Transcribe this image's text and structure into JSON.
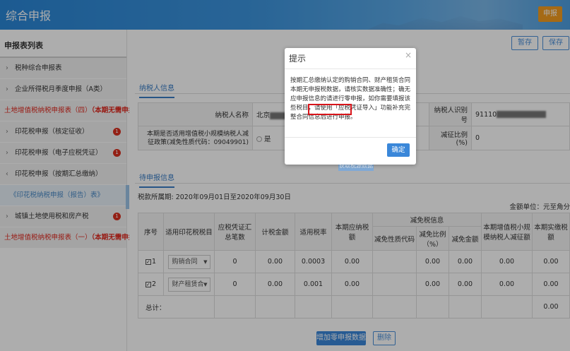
{
  "header": {
    "title": "综合申报",
    "submit_label": "申报"
  },
  "sidebar": {
    "title": "申报表列表",
    "items": [
      {
        "label": "税种综合申报表",
        "type": "normal"
      },
      {
        "label": "企业所得税月季度申报（A类）",
        "type": "normal"
      },
      {
        "label_prefix": "土地增值税纳税申报表（四）",
        "label_bold": "（本期无需申报）",
        "type": "red"
      },
      {
        "label": "印花税申报（核定征收）",
        "type": "normal",
        "badge": "1"
      },
      {
        "label": "印花税申报（电子应税凭证）",
        "type": "normal",
        "badge": "1"
      },
      {
        "label": "印花税申报（按期汇总缴纳）",
        "type": "expanded"
      },
      {
        "label": "《印花税纳税申报（报告）表》",
        "type": "sub"
      },
      {
        "label": "城镇土地使用税和房产税",
        "type": "normal",
        "badge": "1"
      },
      {
        "label_prefix": "土地增值税纳税申报表（一）",
        "label_bold": "（本期无需申报）",
        "type": "red"
      }
    ]
  },
  "toolbar": {
    "save_draft_label": "暂存",
    "save_label": "保存"
  },
  "taxpayer_section": {
    "tab_label": "纳税人信息",
    "name_label": "纳税人名称",
    "name_value_visible": "北京",
    "tax_id_label": "纳税人识别号",
    "tax_id_value_visible": "91110",
    "policy_label": "本期是否适用增值税小规模纳税人减征政策(减免性质代码：09049901)",
    "policy_value": "是",
    "reduction_ratio_label": "减征比例(%)",
    "reduction_ratio_value": "0"
  },
  "pending_section": {
    "tab_label": "待申报信息",
    "period": "税款所属期: 2020年09月01日至2020年09月30日",
    "unit": "金额单位：元至角分",
    "columns": {
      "seq": "序号",
      "item": "适用印花税税目",
      "voucher_count": "应税凭证汇总笔数",
      "tax_base": "计税金额",
      "rate": "适用税率",
      "tax_payable": "本期应纳税额",
      "relief_group": "减免税信息",
      "relief_code": "减免性质代码",
      "relief_ratio": "减免比例（%）",
      "relief_amount": "减免金额",
      "small_scale": "本期增值税小规模纳税人减征额",
      "actual_paid": "本期实缴税额"
    },
    "rows": [
      {
        "seq": "1",
        "checked": true,
        "item": "购销合同",
        "count": "0",
        "base": "0.00",
        "rate": "0.0003",
        "payable": "0.00",
        "code": "",
        "ratio": "0.00",
        "relief": "0.00",
        "small": "0.00",
        "actual": "0.00"
      },
      {
        "seq": "2",
        "checked": true,
        "item": "财产租赁合",
        "count": "0",
        "base": "0.00",
        "rate": "0.001",
        "payable": "0.00",
        "code": "",
        "ratio": "0.00",
        "relief": "0.00",
        "small": "0.00",
        "actual": "0.00"
      }
    ],
    "total_label": "总计：",
    "total_actual": "0.00"
  },
  "actions": {
    "add_zero_label": "增加零申报数据行",
    "delete_label": "删除",
    "hidden_button_label": "获取税源数据"
  },
  "modal": {
    "title": "提示",
    "close_symbol": "×",
    "body": "按期汇总缴纳认定的购销合同、财产租赁合同本期无申报税数据，请核实数据准确性；确无应申报信息的请进行零申报，如你需要填报该些税目，请使用「应税凭证导入」功能补充完整合同信息后进行申报。",
    "ok_label": "确定"
  },
  "colors": {
    "accent": "#3a87d9",
    "header_blue": "#2a86d6",
    "submit_orange": "#f39c1f",
    "alert_red": "#e0271d"
  }
}
